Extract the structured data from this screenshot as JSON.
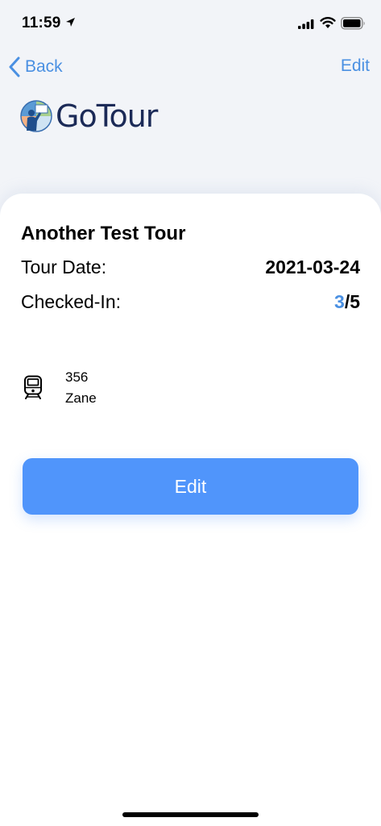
{
  "status_bar": {
    "time": "11:59"
  },
  "nav": {
    "back_label": "Back",
    "edit_label": "Edit"
  },
  "logo": {
    "text": "GoTour"
  },
  "tour": {
    "title": "Another Test Tour",
    "date_label": "Tour Date:",
    "date_value": "2021-03-24",
    "checked_in_label": "Checked-In:",
    "checked_in_count": "3",
    "checked_in_total": "/5"
  },
  "vehicle": {
    "icon": "train-icon",
    "number": "356",
    "driver": "Zane"
  },
  "actions": {
    "edit_button_label": "Edit"
  },
  "colors": {
    "accent": "#4a90e2",
    "button": "#5095fb",
    "logo_text": "#1b2a57",
    "background": "#f2f4f8"
  }
}
